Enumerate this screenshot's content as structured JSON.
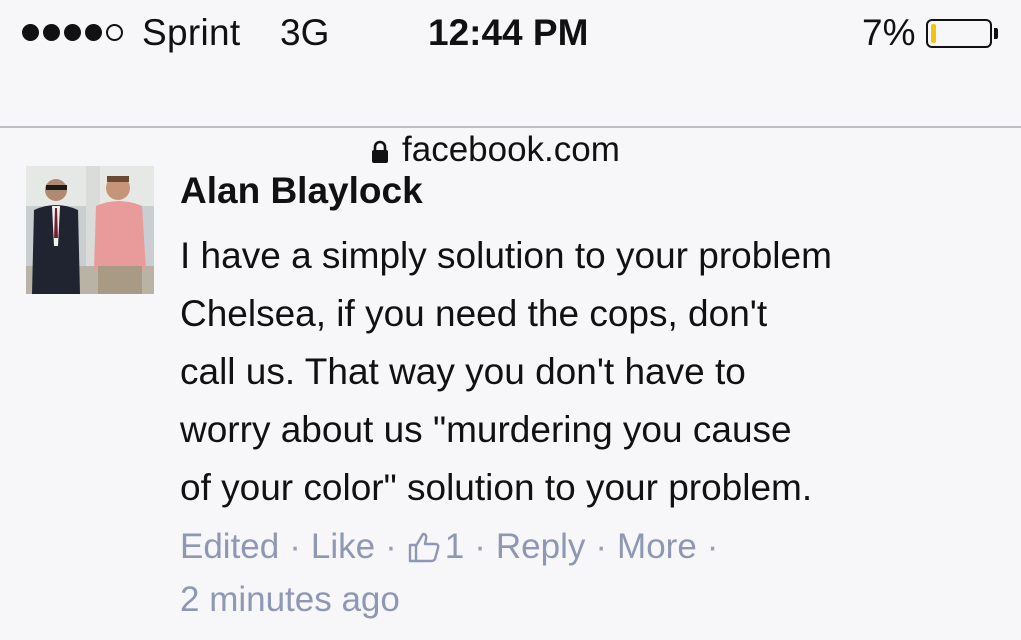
{
  "status_bar": {
    "signal_bars_filled": 4,
    "signal_bars_total": 5,
    "carrier": "Sprint",
    "network": "3G",
    "time": "12:44 PM",
    "battery_percent_label": "7%",
    "battery_level": 0.07,
    "battery_color": "#f1c40f"
  },
  "address_bar": {
    "url": "facebook.com",
    "icon": "lock-icon"
  },
  "comment": {
    "author": "Alan Blaylock",
    "body_lines": [
      "I have a simply solution to your problem",
      "Chelsea, if you need the cops, don't",
      "call us. That way you don't have to",
      "worry about us \"murdering you cause",
      "of your color\" solution to your problem."
    ],
    "actions": {
      "edited": "Edited",
      "like": "Like",
      "like_count": "1",
      "reply": "Reply",
      "more": "More",
      "separator": "·"
    },
    "timestamp": "2 minutes ago"
  },
  "colors": {
    "background": "#f7f7f9",
    "meta_text": "#8e97b3",
    "divider": "#bdbdc3"
  }
}
